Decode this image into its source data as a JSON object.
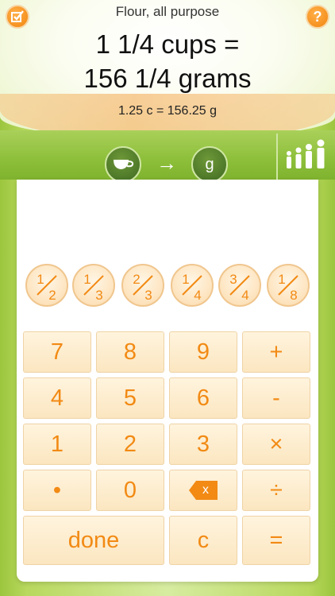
{
  "header": {
    "ingredient": "Flour, all purpose",
    "line1": "1 1/4 cups =",
    "line2": "156 1/4 grams",
    "decimal": "1.25 c = 156.25 g",
    "help_label": "?"
  },
  "units": {
    "from_icon": "cup-icon",
    "to": "g",
    "arrow": "→"
  },
  "fractions": [
    {
      "num": "1",
      "den": "2"
    },
    {
      "num": "1",
      "den": "3"
    },
    {
      "num": "2",
      "den": "3"
    },
    {
      "num": "1",
      "den": "4"
    },
    {
      "num": "3",
      "den": "4"
    },
    {
      "num": "1",
      "den": "8"
    }
  ],
  "keypad": {
    "k7": "7",
    "k8": "8",
    "k9": "9",
    "plus": "+",
    "k4": "4",
    "k5": "5",
    "k6": "6",
    "minus": "-",
    "k1": "1",
    "k2": "2",
    "k3": "3",
    "times": "×",
    "dot": "•",
    "k0": "0",
    "backspace": "x",
    "divide": "÷",
    "done": "done",
    "clear": "c",
    "equals": "="
  },
  "colors": {
    "accent": "#f28a14",
    "green_bar": "#8dbf3a",
    "key_fill": "#fbe6c0"
  }
}
